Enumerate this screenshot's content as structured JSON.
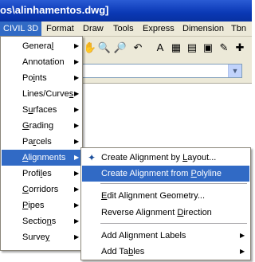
{
  "titlebar": {
    "title": "os\\alinhamentos.dwg]"
  },
  "menubar": {
    "items": [
      "CIVIL 3D",
      "Format",
      "Draw",
      "Tools",
      "Express",
      "Dimension",
      "Tbn"
    ],
    "active": "CIVIL 3D"
  },
  "toolbar": {
    "icons": [
      "hand-icon",
      "zoom-realtime-icon",
      "zoom-window-icon",
      "zoom-previous-icon",
      "text-style-icon",
      "table-icon",
      "properties-icon",
      "design-center-icon",
      "tool-palette-icon",
      "markup-icon"
    ]
  },
  "combo": {
    "value": ""
  },
  "civil_menu": {
    "items": [
      {
        "pre": "Genera",
        "key": "l",
        "post": "",
        "submenu": true
      },
      {
        "pre": "Annotation",
        "key": "",
        "post": "",
        "submenu": true
      },
      {
        "pre": "Po",
        "key": "i",
        "post": "nts",
        "submenu": true
      },
      {
        "pre": "Lines/Curve",
        "key": "s",
        "post": "",
        "submenu": true
      },
      {
        "pre": "S",
        "key": "u",
        "post": "rfaces",
        "submenu": true
      },
      {
        "pre": "",
        "key": "G",
        "post": "rading",
        "submenu": true
      },
      {
        "pre": "Pa",
        "key": "r",
        "post": "cels",
        "submenu": true
      },
      {
        "pre": "",
        "key": "A",
        "post": "lignments",
        "submenu": true
      },
      {
        "pre": "Profi",
        "key": "l",
        "post": "es",
        "submenu": true
      },
      {
        "pre": "",
        "key": "C",
        "post": "orridors",
        "submenu": true
      },
      {
        "pre": "",
        "key": "P",
        "post": "ipes",
        "submenu": true
      },
      {
        "pre": "Sectio",
        "key": "n",
        "post": "s",
        "submenu": true
      },
      {
        "pre": "Surve",
        "key": "y",
        "post": "",
        "submenu": true
      }
    ],
    "highlighted": 7
  },
  "alignments_menu": {
    "items": [
      {
        "pre": "Create Alignment by ",
        "key": "L",
        "post": "ayout...",
        "icon": "create-alignment-layout-icon",
        "submenu": false,
        "highlighted": false
      },
      {
        "pre": "Create Alignment from ",
        "key": "P",
        "post": "olyline",
        "icon": "",
        "submenu": false,
        "highlighted": true
      },
      {
        "pre": "",
        "key": "E",
        "post": "dit Alignment Geometry...",
        "icon": "",
        "submenu": false,
        "highlighted": false
      },
      {
        "pre": "Reverse Alignment ",
        "key": "D",
        "post": "irection",
        "icon": "",
        "submenu": false,
        "highlighted": false
      },
      {
        "pre": "Add Alignment Labels",
        "key": "",
        "post": "",
        "icon": "",
        "submenu": true,
        "highlighted": false
      },
      {
        "pre": "Add Ta",
        "key": "b",
        "post": "les",
        "icon": "",
        "submenu": true,
        "highlighted": false
      }
    ]
  }
}
